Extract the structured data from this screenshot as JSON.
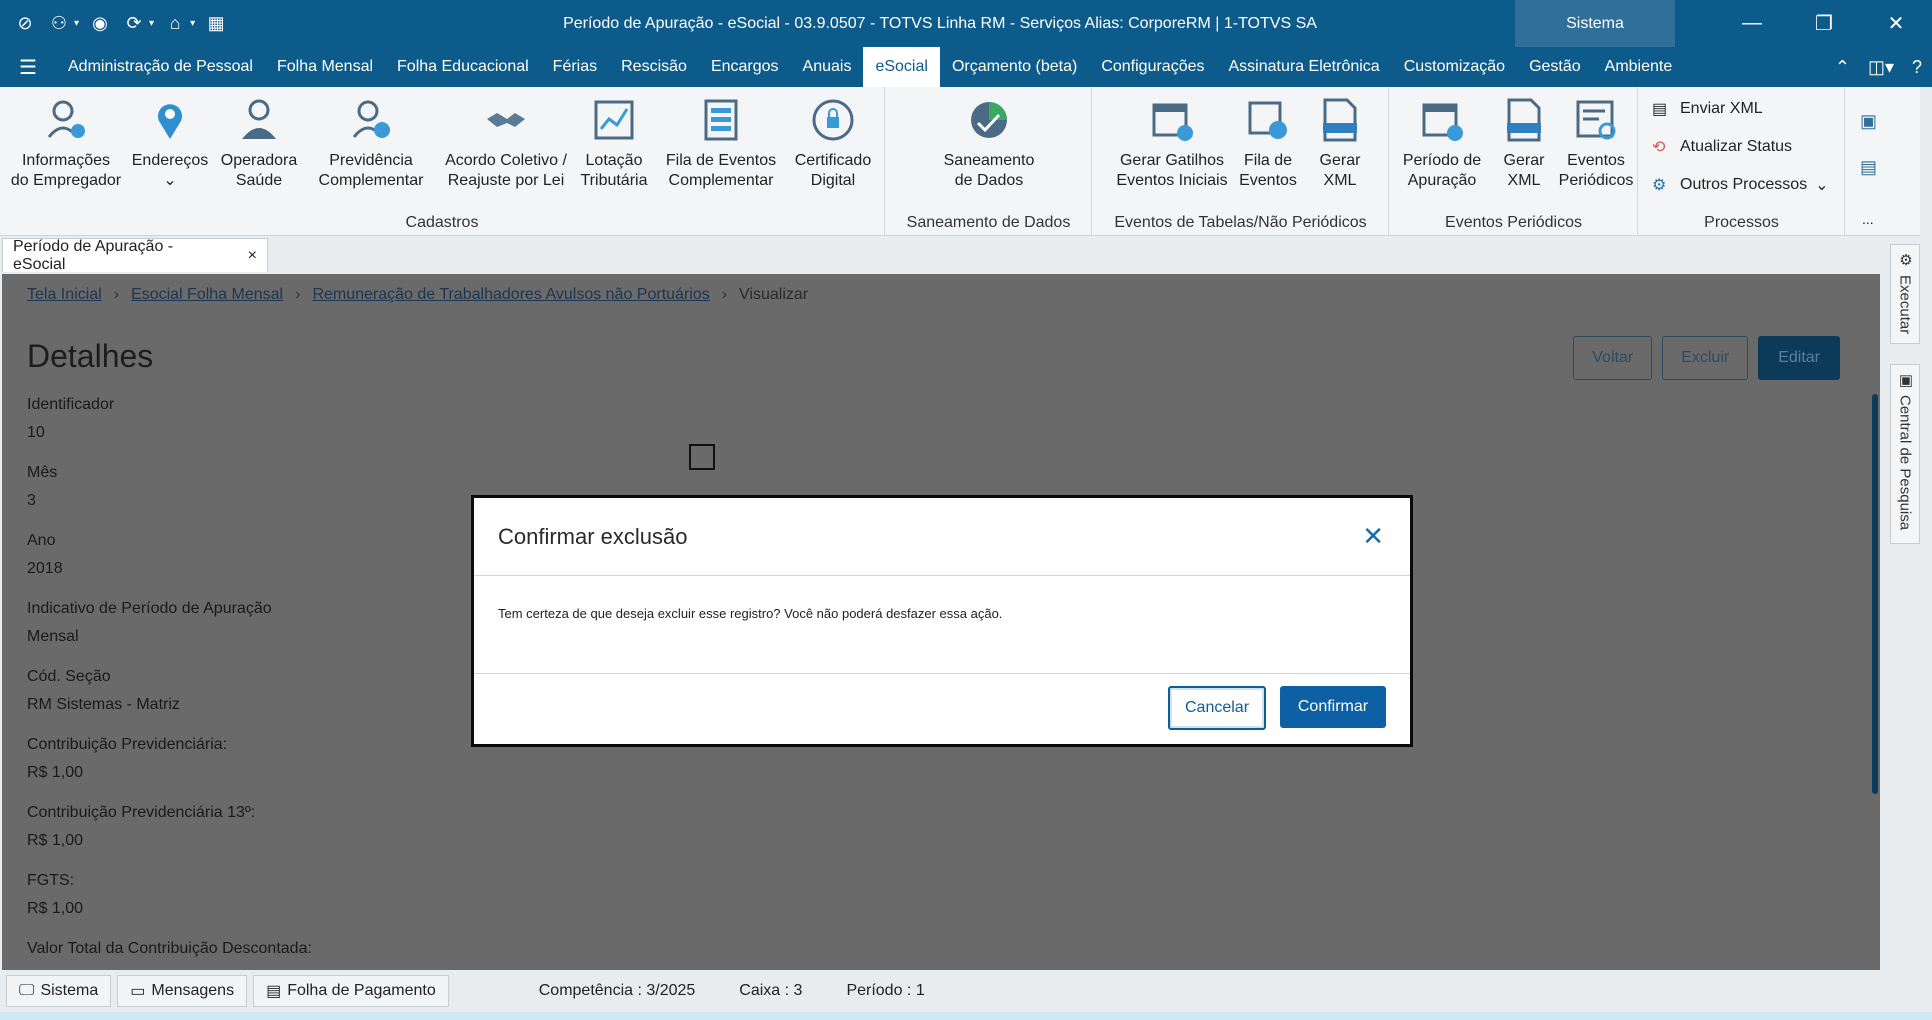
{
  "window": {
    "title": "Período de Apuração - eSocial - 03.9.0507 - TOTVS Linha RM - Serviços  Alias: CorporeRM | 1-TOTVS SA",
    "sistema_label": "Sistema",
    "minimize": "—",
    "restore": "❐",
    "close": "✕"
  },
  "menu": {
    "items": [
      "Administração de Pessoal",
      "Folha Mensal",
      "Folha Educacional",
      "Férias",
      "Rescisão",
      "Encargos",
      "Anuais",
      "eSocial",
      "Orçamento (beta)",
      "Configurações",
      "Assinatura Eletrônica",
      "Customização",
      "Gestão",
      "Ambiente"
    ],
    "active": "eSocial"
  },
  "ribbon": {
    "groups": [
      {
        "label": "Cadastros"
      },
      {
        "label": "Saneamento de Dados"
      },
      {
        "label": "Eventos de Tabelas/Não Periódicos"
      },
      {
        "label": "Eventos Periódicos"
      },
      {
        "label": "Processos"
      }
    ],
    "buttons": {
      "info_empregador": "Informações\ndo Empregador",
      "enderecos": "Endereços",
      "operadora_saude": "Operadora\nSaúde",
      "previdencia": "Previdência\nComplementar",
      "acordo": "Acordo Coletivo /\nReajuste por Lei",
      "lotacao": "Lotação\nTributária",
      "fila_complementar": "Fila de Eventos\nComplementar",
      "certificado": "Certificado\nDigital",
      "saneamento": "Saneamento\nde Dados",
      "gatilhos": "Gerar Gatilhos\nEventos Iniciais",
      "fila_eventos": "Fila de\nEventos",
      "gerar_xml_1": "Gerar\nXML",
      "periodo_apuracao": "Período de\nApuração",
      "gerar_xml_2": "Gerar\nXML",
      "eventos_periodicos": "Eventos\nPeriódicos"
    },
    "processos": {
      "enviar_xml": "Enviar XML",
      "atualizar_status": "Atualizar Status",
      "outros_processos": "Outros Processos"
    },
    "more": "..."
  },
  "doc_tab": {
    "label": "Período de Apuração - eSocial",
    "close": "×"
  },
  "breadcrumb": {
    "items": [
      "Tela Inicial",
      "Esocial Folha Mensal",
      "Remuneração de Trabalhadores Avulsos não Portuários"
    ],
    "current": "Visualizar",
    "sep": "›"
  },
  "page": {
    "title": "Detalhes",
    "actions": {
      "voltar": "Voltar",
      "excluir": "Excluir",
      "editar": "Editar"
    },
    "fields": [
      {
        "label": "Identificador",
        "value": "10"
      },
      {
        "label": "Mês",
        "value": "3"
      },
      {
        "label": "Ano",
        "value": "2018"
      },
      {
        "label": "Indicativo de Período de Apuração",
        "value": "Mensal"
      },
      {
        "label": "Cód. Seção",
        "value": "RM Sistemas - Matriz"
      },
      {
        "label": "Contribuição Previdenciária:",
        "value": "R$ 1,00"
      },
      {
        "label": "Contribuição Previdenciária 13º:",
        "value": "R$ 1,00"
      },
      {
        "label": "FGTS:",
        "value": "R$ 1,00"
      },
      {
        "label": "Valor Total da Contribuição Descontada:",
        "value": ""
      }
    ]
  },
  "side_panel": {
    "executar": "Executar",
    "central": "Central de Pesquisa"
  },
  "modal": {
    "title": "Confirmar exclusão",
    "message": "Tem certeza de que deseja excluir esse registro? Você não poderá desfazer essa ação.",
    "cancel": "Cancelar",
    "confirm": "Confirmar",
    "close": "✕"
  },
  "statusbar": {
    "sistema": "Sistema",
    "mensagens": "Mensagens",
    "folha": "Folha de Pagamento",
    "competencia": "Competência : 3/2025",
    "caixa": "Caixa : 3",
    "periodo": "Período : 1"
  },
  "colors": {
    "brand": "#0d5b8a",
    "overlay": "#6a6a6a",
    "primary_button": "#0c60a3"
  }
}
